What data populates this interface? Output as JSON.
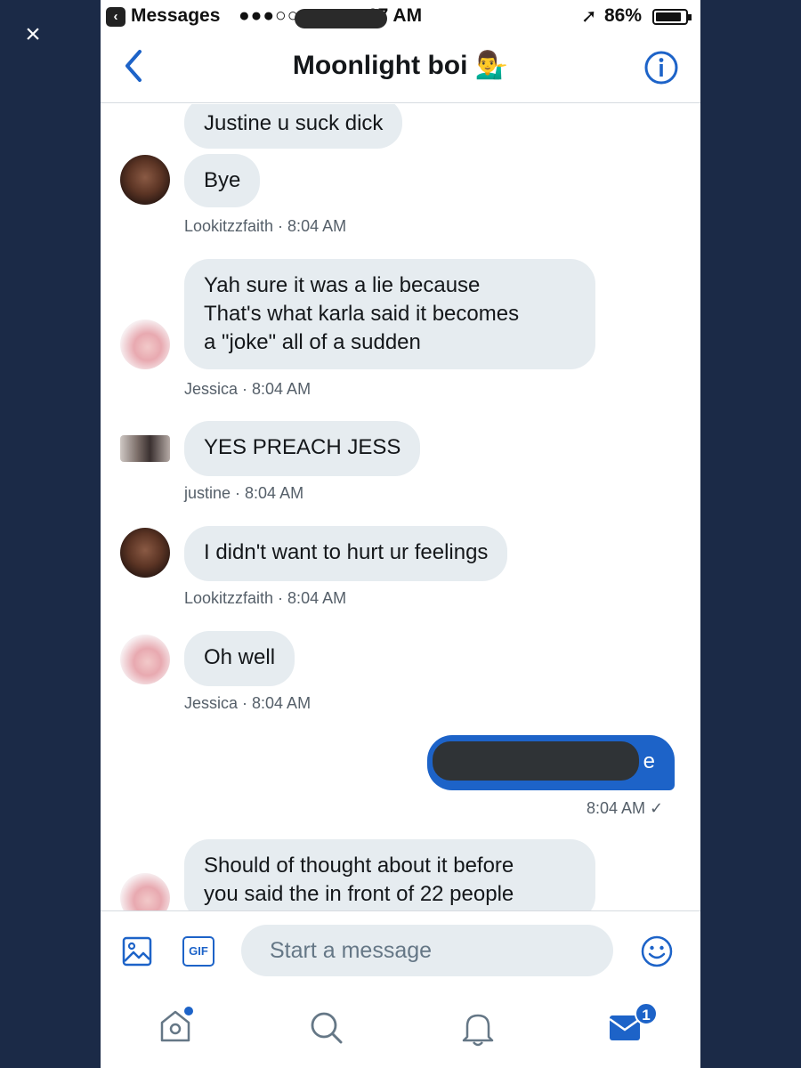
{
  "overlay": {
    "close_glyph": "×"
  },
  "status_bar": {
    "back_app": "Messages",
    "back_glyph": "‹",
    "signal": "●●●○○",
    "time": "07 AM",
    "battery": "86%",
    "battery_level": 0.86,
    "location_glyph": "➚"
  },
  "header": {
    "title": "Moonlight boi 💁‍♂️",
    "back_icon": "chevron-left-icon",
    "info_icon": "info-icon"
  },
  "messages": [
    {
      "text": "Justine u suck dick",
      "sender": "",
      "time": ""
    },
    {
      "text": "Bye",
      "meta": "Lookitzzfaith · 8:04 AM"
    },
    {
      "text": "Yah sure it was a lie because\nThat's what karla said it becomes\na \"joke\" all of a sudden",
      "meta": "Jessica · 8:04 AM"
    },
    {
      "text": "YES PREACH JESS",
      "meta": "justine · 8:04 AM"
    },
    {
      "text": "I didn't want to hurt ur feelings",
      "meta": "Lookitzzfaith · 8:04 AM"
    },
    {
      "text": "Oh well",
      "meta": "Jessica · 8:04 AM"
    },
    {
      "text": "e",
      "meta": "8:04 AM ✓"
    },
    {
      "text": "Should of thought about it before\nyou said the in front of 22 people",
      "meta": ""
    }
  ],
  "composer": {
    "placeholder": "Start a message",
    "gif_label": "GIF"
  },
  "tabs": {
    "messages_badge": "1"
  },
  "colors": {
    "accent": "#1d63c8",
    "bubble_gray": "#e6ecf0",
    "backdrop": "#1b2a47"
  }
}
